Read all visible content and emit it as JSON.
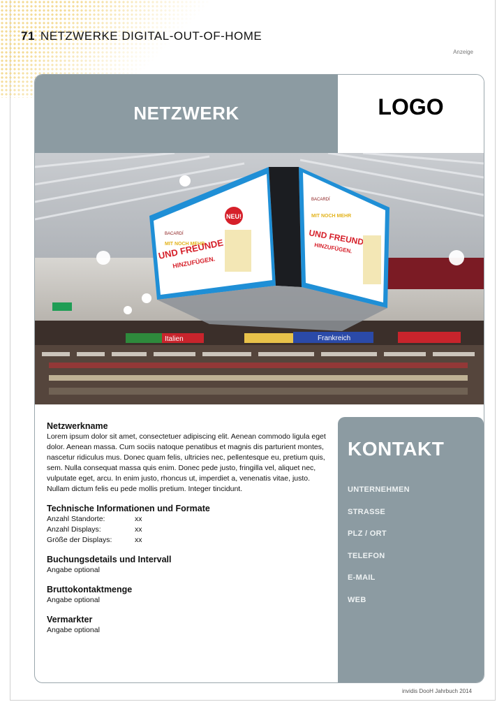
{
  "header": {
    "page_number": "71",
    "title": "NETZWERKE DIGITAL-OUT-OF-HOME",
    "ad_label": "Anzeige"
  },
  "banner": {
    "title": "NETZWERK",
    "logo": "LOGO"
  },
  "photo": {
    "screen_left": {
      "brand": "BACARDÍ",
      "line1": "MIT NOCH MEHR",
      "line2": "UND FREUNDE",
      "line3": "HINZUFÜGEN.",
      "badge": "NEU!"
    },
    "screen_right": {
      "brand": "BACARDÍ",
      "line1": "MIT NOCH MEHR",
      "line2": "UND FREUNDE",
      "line3": "HINZUFÜGEN."
    },
    "shelf_signs": [
      "Italien",
      "Frankreich"
    ]
  },
  "content": {
    "name_heading": "Netzwerkname",
    "description": "Lorem ipsum dolor sit amet, consectetuer adipiscing elit. Aenean commodo ligula eget dolor. Aenean massa. Cum sociis natoque penatibus et magnis dis parturient montes, nascetur ridiculus mus. Donec quam felis, ultricies nec, pellentesque eu, pretium quis, sem. Nulla consequat massa quis enim. Donec pede justo, fringilla vel, aliquet nec, vulputate eget, arcu. In enim justo, rhoncus ut, imperdiet a, venenatis vitae, justo. Nullam dictum felis eu pede mollis pretium. Integer tincidunt.",
    "tech_heading": "Technische Informationen und Formate",
    "specs": [
      {
        "label": "Anzahl Standorte:",
        "value": "xx"
      },
      {
        "label": "Anzahl Displays:",
        "value": "xx"
      },
      {
        "label": "Größe der Displays:",
        "value": "xx"
      }
    ],
    "booking_heading": "Buchungsdetails und Intervall",
    "booking_text": "Angabe optional",
    "contacts_heading": "Bruttokontaktmenge",
    "contacts_text": "Angabe optional",
    "marketer_heading": "Vermarkter",
    "marketer_text": "Angabe optional"
  },
  "kontakt": {
    "title": "KONTAKT",
    "items": [
      "UNTERNEHMEN",
      "STRASSE",
      "PLZ / ORT",
      "TELEFON",
      "E-MAIL",
      "WEB"
    ]
  },
  "footer": {
    "text": "invidis DooH Jahrbuch 2014"
  },
  "colors": {
    "panel": "#8c9ba2",
    "accent_blue": "#1f8fd6"
  }
}
